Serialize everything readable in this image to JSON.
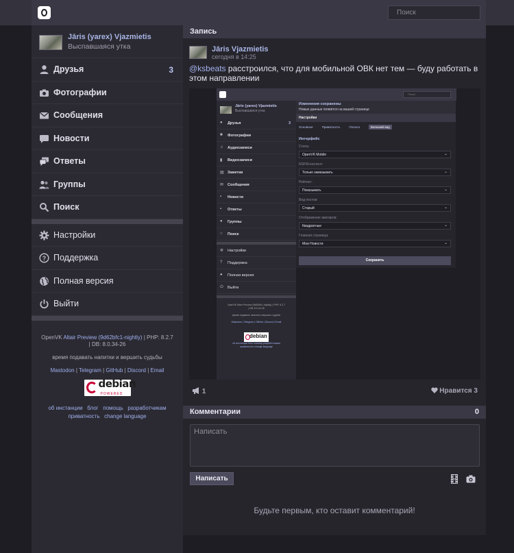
{
  "header": {
    "search_placeholder": "Поиск"
  },
  "profile": {
    "name": "Jāris (yarex) Vjazmietis",
    "status": "Выспавшаяся утка"
  },
  "menu": {
    "friends": {
      "label": "Друзья",
      "count": "3"
    },
    "photos": {
      "label": "Фотографии"
    },
    "messages": {
      "label": "Сообщения"
    },
    "news": {
      "label": "Новости"
    },
    "replies": {
      "label": "Ответы"
    },
    "groups": {
      "label": "Группы"
    },
    "search": {
      "label": "Поиск"
    },
    "settings": {
      "label": "Настройки"
    },
    "support": {
      "label": "Поддержка"
    },
    "full_version": {
      "label": "Полная версия"
    },
    "logout": {
      "label": "Выйти"
    }
  },
  "footer": {
    "prefix": "OpenVK",
    "version_link": "Altair Preview (9d62bfc1-nightly)",
    "php": "| PHP: 8.2.7",
    "db": "| DB: 8.0.34-26",
    "motto": "время подавать напитки и вершить судьбы",
    "links_row1": [
      "Mastodon",
      "Telegram",
      "GitHub",
      "Discord",
      "Email"
    ],
    "links_row2": [
      "об инстанции",
      "блог",
      "помощь",
      "разработчикам"
    ],
    "links_row3": [
      "приватность",
      "change language"
    ],
    "debian_text": "debian",
    "debian_sub": "POWERED"
  },
  "post": {
    "section_title": "Запись",
    "author": "Jāris Vjazmietis",
    "time": "сегодня в 14:25",
    "mention": "@ksbeats",
    "text": " расстроился, что для мобильной ОВК нет тем — буду работать в этом направлении",
    "reposts": "1",
    "likes_label": "Нравится 3"
  },
  "comments": {
    "title": "Комментарии",
    "count": "0",
    "placeholder": "Написать",
    "submit_label": "Написать",
    "empty_text": "Будьте первым, кто оставит комментарий!"
  },
  "screenshot": {
    "search_placeholder": "Поиск",
    "profile_name": "Jāris (yarex) Vjazmietis",
    "profile_status": "Выспавшаяся утка",
    "menu": [
      "Друзья",
      "Фотографии",
      "Аудиозаписи",
      "Видеозаписи",
      "Заметки",
      "Сообщения",
      "Новости",
      "Ответы",
      "Группы",
      "Поиск"
    ],
    "friends_count": "3",
    "menu2": [
      "Настройки",
      "Поддержка",
      "Полная версия",
      "Выйти"
    ],
    "footer_line1": "OpenVK Altair Preview (9d62bfc1-nightly) | PHP: 8.2.7",
    "footer_line2": "| DB: 8.0.34-26",
    "footer_motto": "время подавать напитки и вершить судьбы",
    "footer_links": "Mastodon | Telegram | GitHub | Discord | Email",
    "footer_bottom1": "об инстанции   блог   помощь   разработчикам",
    "footer_bottom2": "приватность   change language",
    "notice_title": "Изменения сохранены",
    "notice_text": "Новые данные появятся на вашей странице",
    "settings_head": "Настройки",
    "tabs": [
      "Основное",
      "Приватность",
      "Полоса",
      "Внешний вид"
    ],
    "interface_title": "Интерфейс",
    "fields": [
      {
        "label": "Стиль:",
        "value": "OpenVK Mobile"
      },
      {
        "label": "NSFW-контент:",
        "value": "Только замазывать"
      },
      {
        "label": "Рейтинг:",
        "value": "Показывать"
      },
      {
        "label": "Вид постов:",
        "value": "Старый"
      },
      {
        "label": "Отображение аватаров:",
        "value": "Квадратные"
      },
      {
        "label": "Главная страница:",
        "value": "Мои Новости"
      }
    ],
    "save_label": "Сохранить"
  }
}
